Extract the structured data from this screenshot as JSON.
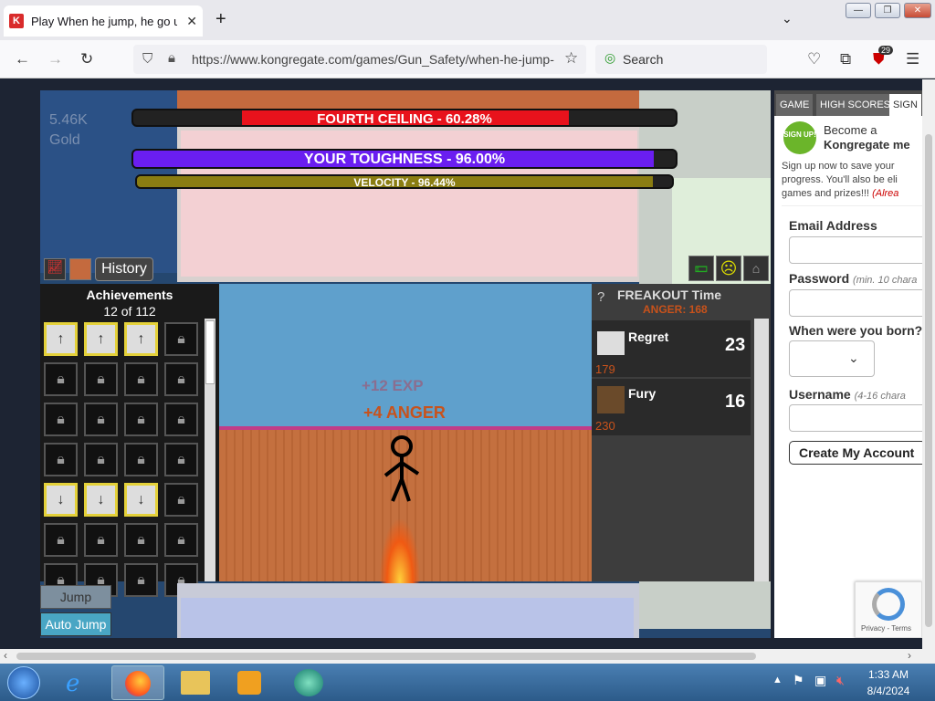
{
  "browser": {
    "tab_title": "Play When he jump, he go up b",
    "url": "https://www.kongregate.com/games/Gun_Safety/when-he-jump-",
    "search_placeholder": "Search",
    "extension_badge": "29"
  },
  "game": {
    "bars": {
      "ceiling": "FOURTH CEILING - 60.28%",
      "ceiling_progress": 0.6028,
      "toughness": "YOUR TOUGHNESS - 96.00%",
      "toughness_progress": 0.96,
      "velocity": "VELOCITY - 96.44%",
      "velocity_progress": 0.9644
    },
    "gold": "5.46K\nGold",
    "history_label": "History",
    "achievements": {
      "title": "Achievements",
      "count": "12 of 112"
    },
    "floating": {
      "exp": "+12 EXP",
      "anger": "+4 ANGER"
    },
    "freakout": {
      "help": "?",
      "title": "FREAKOUT Time",
      "anger": "ANGER: 168",
      "items": [
        {
          "name": "Regret",
          "level": "23",
          "cost": "179"
        },
        {
          "name": "Fury",
          "level": "16",
          "cost": "230"
        }
      ]
    },
    "buttons": {
      "jump": "Jump",
      "auto_jump": "Auto Jump"
    }
  },
  "sidebar": {
    "tabs": [
      "GAME",
      "HIGH SCORES",
      "SIGN"
    ],
    "signup_badge": "SIGN UP!",
    "become": "Become a",
    "kong": "Kongregate me",
    "desc": "Sign up now to save your progress. You'll also be eli games and prizes!!!",
    "desc_link": "(Alrea",
    "email_label": "Email Address",
    "password_label": "Password",
    "password_hint": "(min. 10 chara",
    "born_label": "When were you born?",
    "username_label": "Username",
    "username_hint": "(4-16 chara",
    "create_button": "Create My Account",
    "recaptcha": "Privacy - Terms"
  },
  "taskbar": {
    "time": "1:33 AM",
    "date": "8/4/2024"
  },
  "colors": {
    "ceiling_fill": "#e8121c",
    "toughness_fill": "#6a1ef0",
    "velocity_fill": "#8a7d12",
    "anger_text": "#c8521b"
  }
}
